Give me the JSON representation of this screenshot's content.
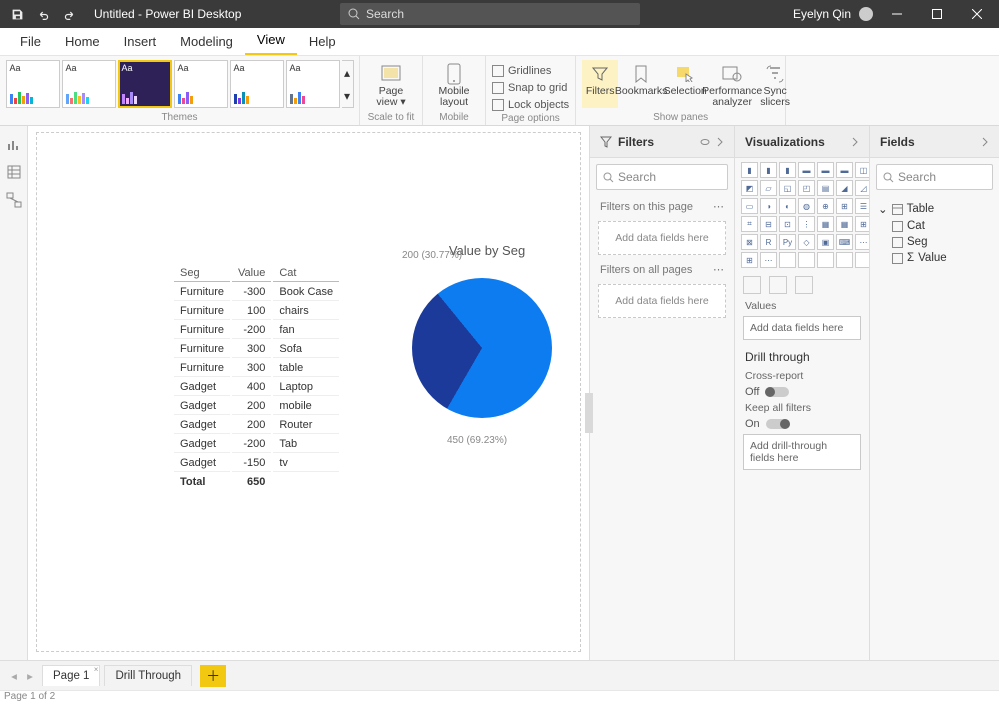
{
  "titlebar": {
    "title": "Untitled - Power BI Desktop",
    "search_ph": "Search",
    "user": "Eyelyn Qin"
  },
  "tabs": [
    "File",
    "Home",
    "Insert",
    "Modeling",
    "View",
    "Help"
  ],
  "active_tab": "View",
  "ribbon": {
    "groups": {
      "themes": "Themes",
      "scale": "Scale to fit",
      "mobile": "Mobile",
      "pageopts": "Page options",
      "showpanes": "Show panes"
    },
    "page_view": {
      "l1": "Page",
      "l2": "view ▾"
    },
    "mobile_layout": {
      "l1": "Mobile",
      "l2": "layout"
    },
    "chk_gridlines": "Gridlines",
    "chk_snap": "Snap to grid",
    "chk_lock": "Lock objects",
    "filters": "Filters",
    "bookmarks": "Bookmarks",
    "selection": "Selection",
    "perf": {
      "l1": "Performance",
      "l2": "analyzer"
    },
    "sync": {
      "l1": "Sync",
      "l2": "slicers"
    }
  },
  "filters_pane": {
    "title": "Filters",
    "search_ph": "Search",
    "on_page": "Filters on this page",
    "all_pages": "Filters on all pages",
    "add_here": "Add data fields here"
  },
  "viz_pane": {
    "title": "Visualizations",
    "values": "Values",
    "add_data": "Add data fields here",
    "drill_through": "Drill through",
    "cross_report": "Cross-report",
    "off": "Off",
    "keep_all": "Keep all filters",
    "on": "On",
    "add_drill": "Add drill-through fields here"
  },
  "fields_pane": {
    "title": "Fields",
    "search_ph": "Search",
    "table": "Table",
    "cat": "Cat",
    "seg": "Seg",
    "value": "Value"
  },
  "table": {
    "headers": {
      "seg": "Seg",
      "value": "Value",
      "cat": "Cat"
    },
    "rows": [
      {
        "seg": "Furniture",
        "value": "-300",
        "cat": "Book Case"
      },
      {
        "seg": "Furniture",
        "value": "100",
        "cat": "chairs"
      },
      {
        "seg": "Furniture",
        "value": "-200",
        "cat": "fan"
      },
      {
        "seg": "Furniture",
        "value": "300",
        "cat": "Sofa"
      },
      {
        "seg": "Furniture",
        "value": "300",
        "cat": "table"
      },
      {
        "seg": "Gadget",
        "value": "400",
        "cat": "Laptop"
      },
      {
        "seg": "Gadget",
        "value": "200",
        "cat": "mobile"
      },
      {
        "seg": "Gadget",
        "value": "200",
        "cat": "Router"
      },
      {
        "seg": "Gadget",
        "value": "-200",
        "cat": "Tab"
      },
      {
        "seg": "Gadget",
        "value": "-150",
        "cat": "tv"
      }
    ],
    "total_label": "Total",
    "total_value": "650"
  },
  "chart_data": {
    "type": "pie",
    "title": "Value by Seg",
    "slices": [
      {
        "label": "200 (30.77%)",
        "value": 200,
        "pct": 30.77,
        "color": "#1c3a99"
      },
      {
        "label": "450 (69.23%)",
        "value": 450,
        "pct": 69.23,
        "color": "#0d7cf0"
      }
    ]
  },
  "pages": {
    "p1": "Page 1",
    "p2": "Drill Through"
  },
  "status": "Page 1 of 2"
}
